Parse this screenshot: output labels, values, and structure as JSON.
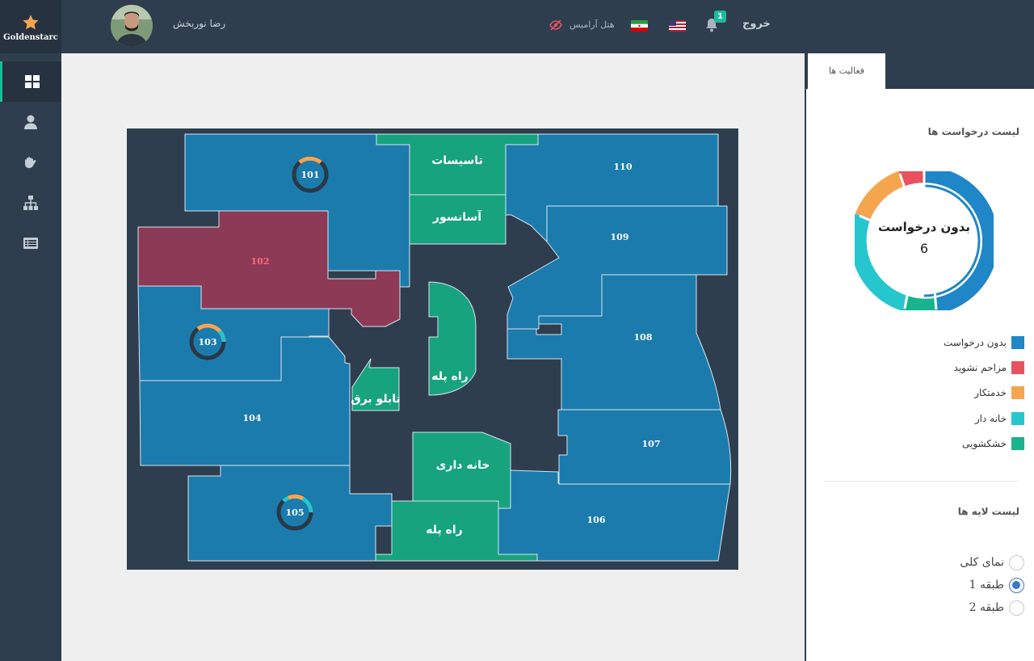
{
  "brand": {
    "name": "Goldenstarc",
    "icon": "star-icon"
  },
  "header": {
    "username": "رضا نوربخش",
    "hotel_name": "هتل آرامیس",
    "notification_count": "1",
    "logout_label": "خروج"
  },
  "sidebar": {
    "items": [
      {
        "icon": "dashboard-icon",
        "active": true
      },
      {
        "icon": "user-icon",
        "active": false
      },
      {
        "icon": "hand-icon",
        "active": false
      },
      {
        "icon": "sitemap-icon",
        "active": false
      },
      {
        "icon": "list-icon",
        "active": false
      }
    ]
  },
  "floorplan": {
    "rooms": [
      {
        "number": "101",
        "status": "no-request"
      },
      {
        "number": "102",
        "status": "do-not-disturb"
      },
      {
        "number": "103",
        "status": "no-request"
      },
      {
        "number": "104",
        "status": "no-request"
      },
      {
        "number": "105",
        "status": "no-request"
      },
      {
        "number": "106",
        "status": "no-request"
      },
      {
        "number": "107",
        "status": "no-request"
      },
      {
        "number": "108",
        "status": "no-request"
      },
      {
        "number": "109",
        "status": "no-request"
      },
      {
        "number": "110",
        "status": "no-request"
      }
    ],
    "areas": {
      "facilities": "تاسیسات",
      "elevator": "آسانسور",
      "stairs_center": "راه پله",
      "electric_panel": "تابلو برق",
      "housekeeping": "خانه داری",
      "stairs_bottom": "راه پله"
    }
  },
  "panel": {
    "tab_label": "فعالیت ها",
    "requests_title": "لیست درخواست ها",
    "donut_center_label": "بدون درخواست",
    "donut_center_value": "6",
    "legend": [
      {
        "label": "بدون درخواست",
        "color": "#1f86c8"
      },
      {
        "label": "مزاحم نشوید",
        "color": "#e8525f"
      },
      {
        "label": "خدمتکار",
        "color": "#f5a54e"
      },
      {
        "label": "خانه دار",
        "color": "#26c6cf"
      },
      {
        "label": "خشکشویی",
        "color": "#19b38e"
      }
    ],
    "layers_title": "لیست لایه ها",
    "layers": [
      {
        "label": "نمای کلی",
        "checked": false
      },
      {
        "label": "طبقه 1",
        "checked": true
      },
      {
        "label": "طبقه 2",
        "checked": false
      }
    ]
  },
  "colors": {
    "room_blue": "#1b7bad",
    "room_dnd": "#8c3a55",
    "service_green": "#17a37e",
    "corridor": "#2e3e4e",
    "accent": "#1abc9c"
  }
}
